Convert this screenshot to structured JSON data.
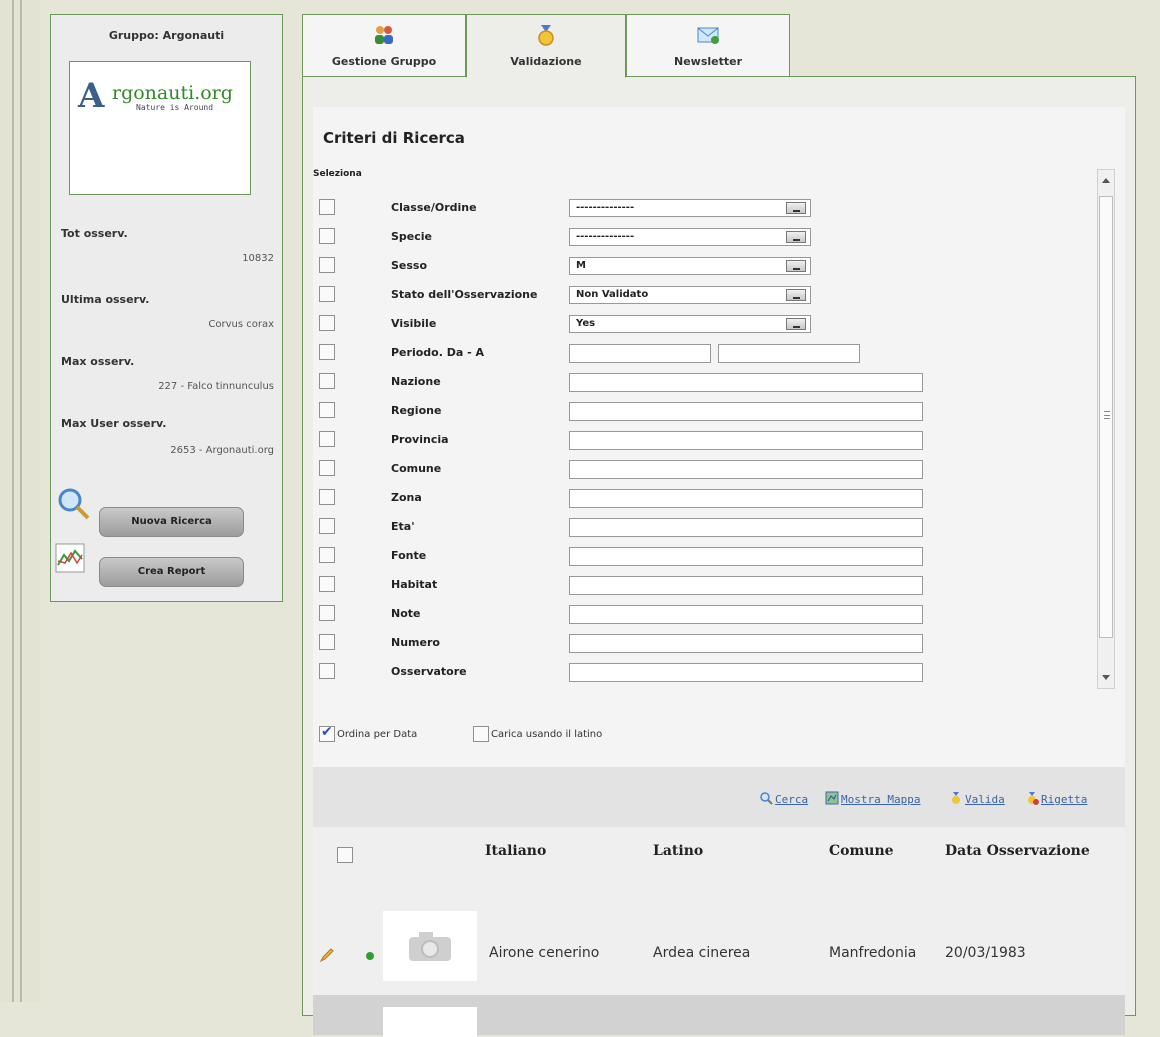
{
  "sidebar": {
    "group_title": "Gruppo: Argonauti",
    "logo_brand": "rgonauti.org",
    "logo_tagline": "Nature is Around",
    "stats": [
      {
        "label": "Tot osserv.",
        "value": "10832"
      },
      {
        "label": "Ultima osserv.",
        "value": "Corvus corax"
      },
      {
        "label": "Max osserv.",
        "value": "227 - Falco tinnunculus"
      },
      {
        "label": "Max User osserv.",
        "value": "2653 - Argonauti.org"
      }
    ],
    "buttons": {
      "new_search": "Nuova Ricerca",
      "create_report": "Crea Report"
    }
  },
  "tabs": [
    {
      "label": "Gestione Gruppo",
      "icon": "group-icon"
    },
    {
      "label": "Validazione",
      "icon": "medal-icon"
    },
    {
      "label": "Newsletter",
      "icon": "email-icon"
    }
  ],
  "criteria": {
    "title": "Criteri di Ricerca",
    "select_header": "Seleziona",
    "fields": [
      {
        "label": "Classe/Ordine",
        "type": "select",
        "value": "--------------"
      },
      {
        "label": "Specie",
        "type": "select",
        "value": "--------------"
      },
      {
        "label": "Sesso",
        "type": "select",
        "value": "M"
      },
      {
        "label": "Stato dell'Osservazione",
        "type": "select",
        "value": "Non Validato"
      },
      {
        "label": "Visibile",
        "type": "select",
        "value": "Yes"
      },
      {
        "label": "Periodo. Da - A",
        "type": "range",
        "value": ""
      },
      {
        "label": "Nazione",
        "type": "text",
        "value": ""
      },
      {
        "label": "Regione",
        "type": "text",
        "value": ""
      },
      {
        "label": "Provincia",
        "type": "text",
        "value": ""
      },
      {
        "label": "Comune",
        "type": "text",
        "value": ""
      },
      {
        "label": "Zona",
        "type": "text",
        "value": ""
      },
      {
        "label": "Eta'",
        "type": "text",
        "value": ""
      },
      {
        "label": "Fonte",
        "type": "text",
        "value": ""
      },
      {
        "label": "Habitat",
        "type": "text",
        "value": ""
      },
      {
        "label": "Note",
        "type": "text",
        "value": ""
      },
      {
        "label": "Numero",
        "type": "text",
        "value": ""
      },
      {
        "label": "Osservatore",
        "type": "text",
        "value": ""
      }
    ],
    "options": {
      "order_by_date": {
        "label": "Ordina per Data",
        "checked": true
      },
      "load_latin": {
        "label": "Carica usando il latino",
        "checked": false
      }
    }
  },
  "toolbar": {
    "search": "Cerca",
    "show_map": "Mostra Mappa",
    "validate": "Valida",
    "reject": "Rigetta"
  },
  "results": {
    "headers": {
      "italian": "Italiano",
      "latin": "Latino",
      "comune": "Comune",
      "date": "Data Osservazione"
    },
    "rows": [
      {
        "italian": "Airone cenerino",
        "latin": "Ardea cinerea",
        "comune": "Manfredonia",
        "date": "20/03/1983",
        "status_color": "#2fa02f"
      }
    ]
  }
}
